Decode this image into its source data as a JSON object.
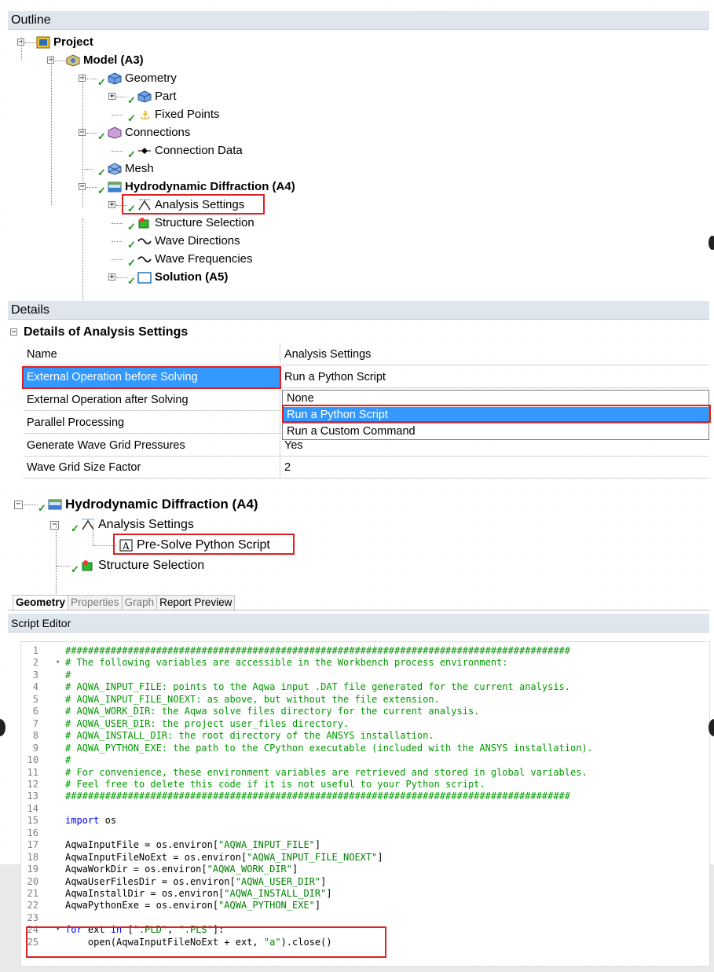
{
  "outline": {
    "header": "Outline",
    "items": [
      {
        "label": "Project",
        "bold": true
      },
      {
        "label": "Model (A3)",
        "bold": true
      },
      {
        "label": "Geometry",
        "bold": false
      },
      {
        "label": "Part",
        "bold": false
      },
      {
        "label": "Fixed Points",
        "bold": false
      },
      {
        "label": "Connections",
        "bold": false
      },
      {
        "label": "Connection Data",
        "bold": false
      },
      {
        "label": "Mesh",
        "bold": false
      },
      {
        "label": "Hydrodynamic Diffraction (A4)",
        "bold": true
      },
      {
        "label": "Analysis Settings",
        "bold": false,
        "highlighted": true
      },
      {
        "label": "Structure Selection",
        "bold": false
      },
      {
        "label": "Wave Directions",
        "bold": false
      },
      {
        "label": "Wave Frequencies",
        "bold": false
      },
      {
        "label": "Solution (A5)",
        "bold": true
      }
    ]
  },
  "details": {
    "header": "Details",
    "group_title": "Details of Analysis Settings",
    "rows": [
      {
        "name": "Name",
        "value": "Analysis Settings"
      },
      {
        "name": "External Operation before Solving",
        "value": "Run a Python Script"
      },
      {
        "name": "External Operation after Solving",
        "value": ""
      },
      {
        "name": "Parallel Processing",
        "value": ""
      },
      {
        "name": "Generate Wave Grid Pressures",
        "value": "Yes"
      },
      {
        "name": "Wave Grid Size Factor",
        "value": "2"
      }
    ],
    "dropdown_options": [
      "None",
      "Run a Python Script",
      "Run a Custom Command"
    ],
    "dropdown_selected": "Run a Python Script"
  },
  "tree2": {
    "items": [
      {
        "label": "Hydrodynamic Diffraction (A4)"
      },
      {
        "label": "Analysis Settings"
      },
      {
        "label": "Pre-Solve Python Script"
      },
      {
        "label": "Structure Selection"
      }
    ]
  },
  "tabs": [
    "Geometry",
    "Properties",
    "Graph",
    "Report Preview"
  ],
  "script_editor": {
    "header": "Script Editor",
    "lines": [
      {
        "n": "1",
        "text": "#########################################################################################",
        "type": "cmt"
      },
      {
        "n": "2",
        "text": "# The following variables are accessible in the Workbench process environment:",
        "type": "cmt"
      },
      {
        "n": "3",
        "text": "#",
        "type": "cmt"
      },
      {
        "n": "4",
        "text": "# AQWA_INPUT_FILE: points to the Aqwa input .DAT file generated for the current analysis.",
        "type": "cmt"
      },
      {
        "n": "5",
        "text": "# AQWA_INPUT_FILE_NOEXT: as above, but without the file extension.",
        "type": "cmt"
      },
      {
        "n": "6",
        "text": "# AQWA_WORK_DIR: the Aqwa solve files directory for the current analysis.",
        "type": "cmt"
      },
      {
        "n": "7",
        "text": "# AQWA_USER_DIR: the project user_files directory.",
        "type": "cmt"
      },
      {
        "n": "8",
        "text": "# AQWA_INSTALL_DIR: the root directory of the ANSYS installation.",
        "type": "cmt"
      },
      {
        "n": "9",
        "text": "# AQWA_PYTHON_EXE: the path to the CPython executable (included with the ANSYS installation).",
        "type": "cmt"
      },
      {
        "n": "10",
        "text": "#",
        "type": "cmt"
      },
      {
        "n": "11",
        "text": "# For convenience, these environment variables are retrieved and stored in global variables.",
        "type": "cmt"
      },
      {
        "n": "12",
        "text": "# Feel free to delete this code if it is not useful to your Python script.",
        "type": "cmt"
      },
      {
        "n": "13",
        "text": "#########################################################################################",
        "type": "cmt"
      },
      {
        "n": "14",
        "text": "",
        "type": "code"
      },
      {
        "n": "15",
        "text": "import os",
        "type": "import"
      },
      {
        "n": "16",
        "text": "",
        "type": "code"
      },
      {
        "n": "17",
        "text": "AqwaInputFile = os.environ[\"AQWA_INPUT_FILE\"]",
        "type": "assign"
      },
      {
        "n": "18",
        "text": "AqwaInputFileNoExt = os.environ[\"AQWA_INPUT_FILE_NOEXT\"]",
        "type": "assign"
      },
      {
        "n": "19",
        "text": "AqwaWorkDir = os.environ[\"AQWA_WORK_DIR\"]",
        "type": "assign"
      },
      {
        "n": "20",
        "text": "AqwaUserFilesDir = os.environ[\"AQWA_USER_DIR\"]",
        "type": "assign"
      },
      {
        "n": "21",
        "text": "AqwaInstallDir = os.environ[\"AQWA_INSTALL_DIR\"]",
        "type": "assign"
      },
      {
        "n": "22",
        "text": "AqwaPythonExe = os.environ[\"AQWA_PYTHON_EXE\"]",
        "type": "assign"
      },
      {
        "n": "23",
        "text": "",
        "type": "code"
      },
      {
        "n": "24",
        "text": "for ext in [\".PLD\", \".PLS\"]:",
        "type": "for"
      },
      {
        "n": "25",
        "text": "    open(AqwaInputFileNoExt + ext, \"a\").close()",
        "type": "code"
      }
    ]
  }
}
